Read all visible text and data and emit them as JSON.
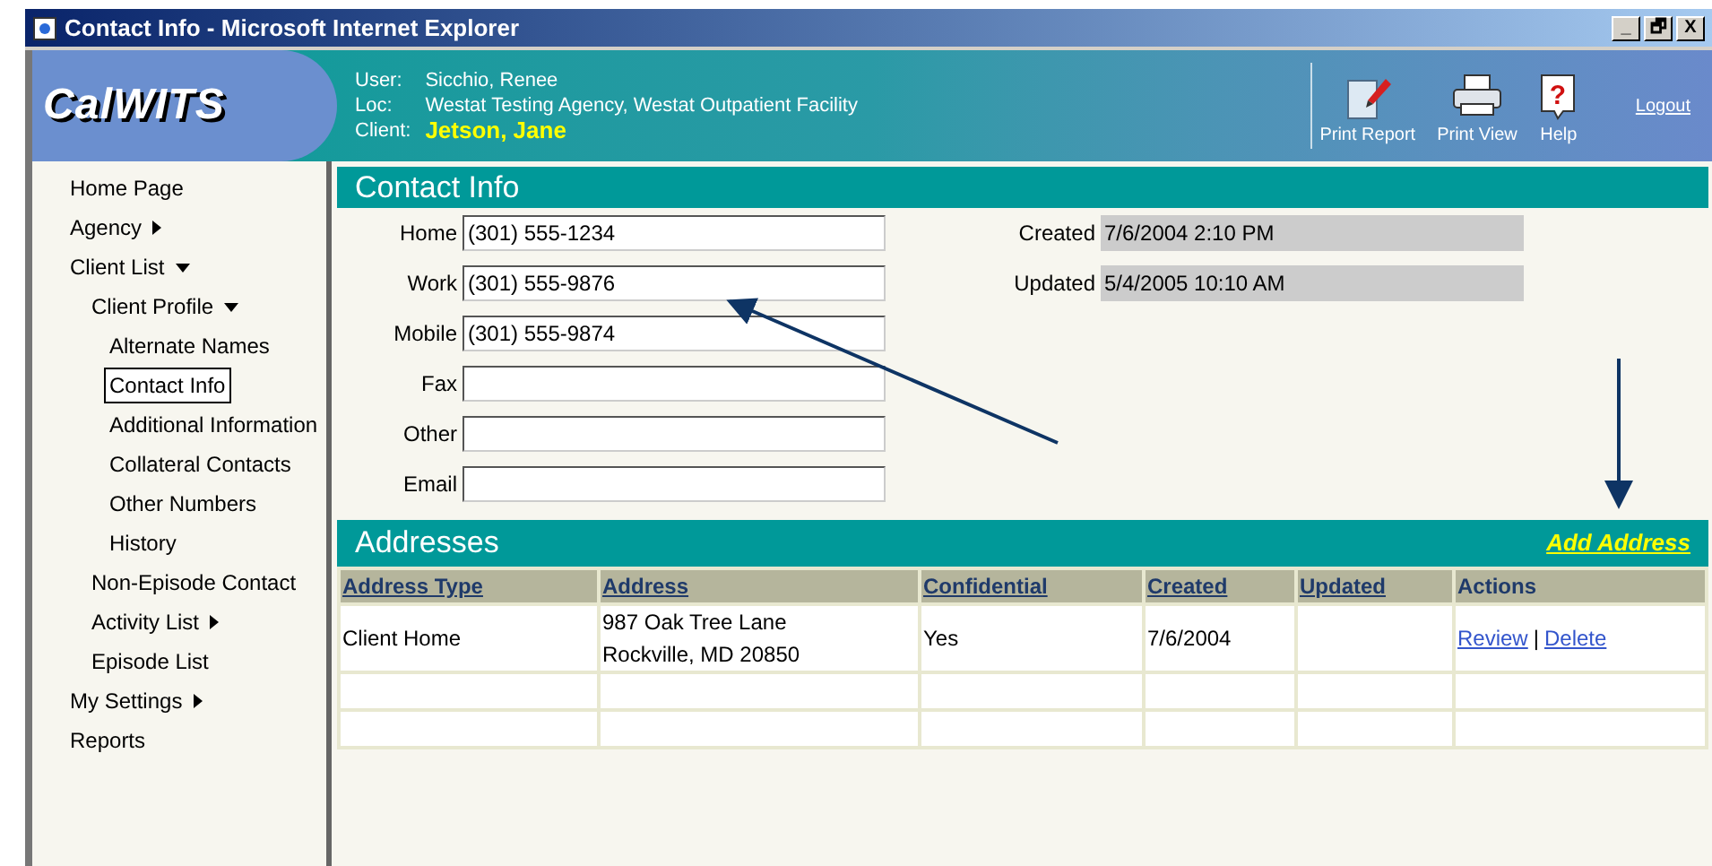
{
  "window": {
    "title": "Contact Info - Microsoft Internet Explorer",
    "controls": [
      "_",
      "🗗",
      "X"
    ]
  },
  "header": {
    "logo": "CalWITS",
    "user_label": "User:",
    "user": "Sicchio, Renee",
    "loc_label": "Loc:",
    "loc": "Westat Testing Agency, Westat Outpatient Facility",
    "client_label": "Client:",
    "client": "Jetson, Jane",
    "toolbar": [
      {
        "kind": "report",
        "label": "Print Report"
      },
      {
        "kind": "print",
        "label": "Print View"
      },
      {
        "kind": "help",
        "label": "Help",
        "glyph": "?"
      }
    ],
    "logout": "Logout"
  },
  "sidebar": {
    "items": [
      {
        "label": "Home Page",
        "selected": false
      },
      {
        "label": "Agency",
        "expanded": false,
        "selected": false
      },
      {
        "label": "Client List",
        "expanded": true,
        "selected": false,
        "children": [
          {
            "label": "Client Profile",
            "expanded": true,
            "selected": false,
            "children": [
              {
                "label": "Alternate Names",
                "selected": false
              },
              {
                "label": "Contact Info",
                "selected": true
              },
              {
                "label": "Additional Information",
                "selected": false
              },
              {
                "label": "Collateral Contacts",
                "selected": false
              },
              {
                "label": "Other Numbers",
                "selected": false
              },
              {
                "label": "History",
                "selected": false
              }
            ]
          },
          {
            "label": "Non-Episode Contact",
            "selected": false
          },
          {
            "label": "Activity List",
            "expanded": false,
            "selected": false
          },
          {
            "label": "Episode List",
            "selected": false
          }
        ]
      },
      {
        "label": "My Settings",
        "expanded": false,
        "selected": false
      },
      {
        "label": "Reports",
        "selected": false
      }
    ]
  },
  "contact": {
    "title": "Contact Info",
    "fields": [
      {
        "label": "Home",
        "value": "(301) 555-1234"
      },
      {
        "label": "Work",
        "value": "(301) 555-9876"
      },
      {
        "label": "Mobile",
        "value": "(301) 555-9874"
      },
      {
        "label": "Fax"
      },
      {
        "label": "Other"
      },
      {
        "label": "Email"
      }
    ],
    "audit": [
      {
        "label": "Created",
        "value": "7/6/2004 2:10 PM"
      },
      {
        "label": "Updated",
        "value": "5/4/2005 10:10 AM"
      }
    ]
  },
  "addresses": {
    "title": "Addresses",
    "add_link": "Add Address",
    "table": {
      "columns": [
        {
          "label": "Address Type",
          "sortable": true
        },
        {
          "label": "Address",
          "sortable": true
        },
        {
          "label": "Confidential",
          "sortable": true
        },
        {
          "label": "Created",
          "sortable": true
        },
        {
          "label": "Updated",
          "sortable": true
        },
        {
          "label": "Actions",
          "sortable": false
        }
      ],
      "rows": [
        {
          "type": "Client Home",
          "address": [
            "987 Oak Tree Lane",
            "Rockville, MD 20850"
          ],
          "confidential": "Yes",
          "created": "7/6/2004",
          "actions": [
            "Review",
            "Delete"
          ],
          "separator": "|"
        }
      ]
    }
  }
}
